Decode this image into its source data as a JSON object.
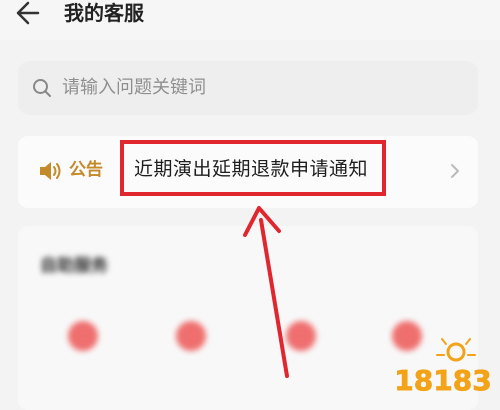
{
  "header": {
    "title": "我的客服"
  },
  "search": {
    "placeholder": "请输入问题关键词"
  },
  "notice": {
    "label": "公告",
    "text": "近期演出延期退款申请通知"
  },
  "services": {
    "title": "自助服务",
    "items": [
      {
        "label": ""
      },
      {
        "label": ""
      },
      {
        "label": ""
      },
      {
        "label": ""
      }
    ]
  },
  "colors": {
    "accent_gold": "#c48a2a",
    "highlight_red": "#e0262e",
    "service_icon_red": "#ef6f6f",
    "watermark_orange": "#f2a318"
  },
  "icons": {
    "back": "arrow-left-icon",
    "search": "search-icon",
    "speaker": "speaker-icon",
    "chevron": "chevron-right-icon"
  },
  "watermark": {
    "text": "18183"
  }
}
